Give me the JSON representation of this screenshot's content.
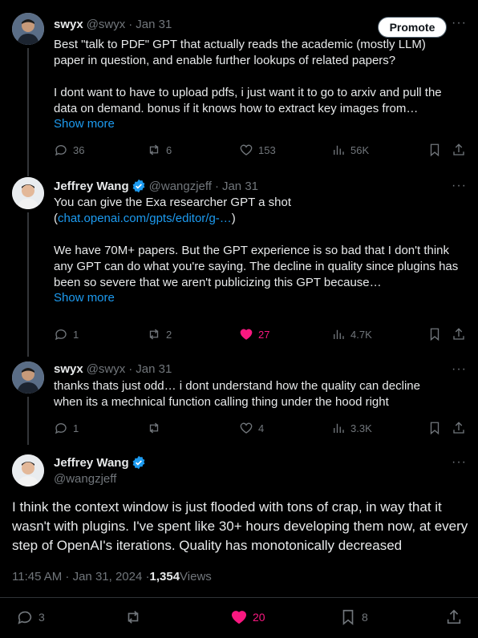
{
  "tweet1": {
    "author_name": "swyx",
    "handle": "@swyx",
    "date": "Jan 31",
    "promote_label": "Promote",
    "text": "Best \"talk to PDF\" GPT that actually reads the academic (mostly LLM)\npaper in question, and enable further lookups of related papers?\n\nI dont want to have to upload pdfs, i just want it to go to arxiv and pull the\ndata on demand. bonus if it knows how to extract key images from…",
    "show_more": "Show more",
    "replies": "36",
    "reposts": "6",
    "likes": "153",
    "views": "56K"
  },
  "tweet2": {
    "author_name": "Jeffrey Wang",
    "handle": "@wangzjeff",
    "date": "Jan 31",
    "text_before_link": "You can give the Exa researcher GPT a shot\n(",
    "link": "chat.openai.com/gpts/editor/g-…",
    "text_after_link": ")\n\nWe have 70M+ papers. But the GPT experience is so bad that I don't think\nany GPT can do what you're saying. The decline in quality since plugins has\nbeen so severe that we aren't publicizing this GPT because…",
    "show_more": "Show more",
    "replies": "1",
    "reposts": "2",
    "likes": "27",
    "views": "4.7K"
  },
  "tweet3": {
    "author_name": "swyx",
    "handle": "@swyx",
    "date": "Jan 31",
    "text": "thanks thats just odd… i dont understand how the quality can decline\nwhen its a mechnical function calling thing under the hood right",
    "replies": "1",
    "reposts": "",
    "likes": "4",
    "views": "3.3K"
  },
  "main_tweet": {
    "author_name": "Jeffrey Wang",
    "handle": "@wangzjeff",
    "text": "I think the context window is just flooded with tons of crap, in way that it wasn't with plugins. I've spent like 30+ hours developing them now, at every step of OpenAI's iterations. Quality has monotonically decreased",
    "timestamp": "11:45 AM · Jan 31, 2024 · ",
    "views_count": "1,354",
    "views_label": " Views",
    "replies": "3",
    "reposts": "",
    "likes": "20",
    "bookmarks": "8"
  },
  "colors": {
    "accent": "#1d9bf0",
    "like": "#f91880",
    "muted": "#71767b"
  }
}
